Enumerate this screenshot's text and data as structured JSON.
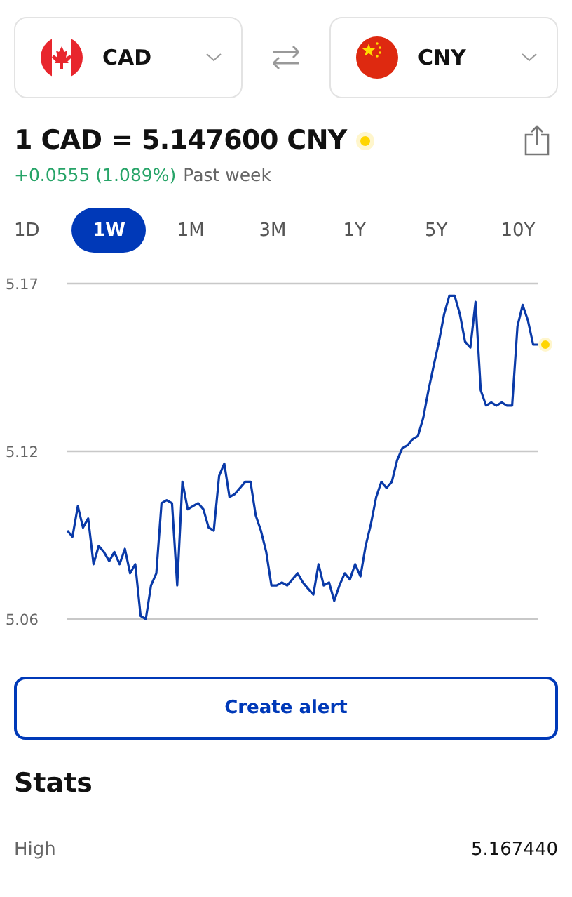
{
  "converter": {
    "from": {
      "code": "CAD",
      "kind": "canada"
    },
    "to": {
      "code": "CNY",
      "kind": "china"
    }
  },
  "rate": {
    "text": "1 CAD = 5.147600 CNY",
    "live": true,
    "change": "+0.0555 (1.089%)",
    "period": "Past week"
  },
  "periods": [
    {
      "label": "1D",
      "selected": false
    },
    {
      "label": "1W",
      "selected": true
    },
    {
      "label": "1M",
      "selected": false
    },
    {
      "label": "3M",
      "selected": false
    },
    {
      "label": "1Y",
      "selected": false
    },
    {
      "label": "5Y",
      "selected": false
    },
    {
      "label": "10Y",
      "selected": false
    }
  ],
  "chart_data": {
    "type": "line",
    "ylim": [
      5.06,
      5.17
    ],
    "yticks": [
      {
        "value": 5.06,
        "label": "5.06"
      },
      {
        "value": 5.115,
        "label": "5.12"
      },
      {
        "value": 5.17,
        "label": "5.17"
      }
    ],
    "values": [
      5.089,
      5.087,
      5.097,
      5.09,
      5.093,
      5.078,
      5.084,
      5.082,
      5.079,
      5.082,
      5.078,
      5.083,
      5.075,
      5.078,
      5.061,
      5.06,
      5.071,
      5.075,
      5.098,
      5.099,
      5.098,
      5.071,
      5.105,
      5.096,
      5.097,
      5.098,
      5.096,
      5.09,
      5.089,
      5.107,
      5.111,
      5.1,
      5.101,
      5.103,
      5.105,
      5.105,
      5.094,
      5.089,
      5.082,
      5.071,
      5.071,
      5.072,
      5.071,
      5.073,
      5.075,
      5.072,
      5.07,
      5.068,
      5.078,
      5.071,
      5.072,
      5.066,
      5.071,
      5.075,
      5.073,
      5.078,
      5.074,
      5.084,
      5.091,
      5.1,
      5.105,
      5.103,
      5.105,
      5.112,
      5.116,
      5.117,
      5.119,
      5.12,
      5.126,
      5.135,
      5.143,
      5.151,
      5.16,
      5.166,
      5.166,
      5.16,
      5.151,
      5.149,
      5.164,
      5.135,
      5.13,
      5.131,
      5.13,
      5.131,
      5.13,
      5.13,
      5.156,
      5.163,
      5.158,
      5.15,
      5.15
    ]
  },
  "alert_button": "Create alert",
  "stats": {
    "title": "Stats",
    "rows": [
      {
        "label": "High",
        "value": "5.167440"
      }
    ]
  }
}
